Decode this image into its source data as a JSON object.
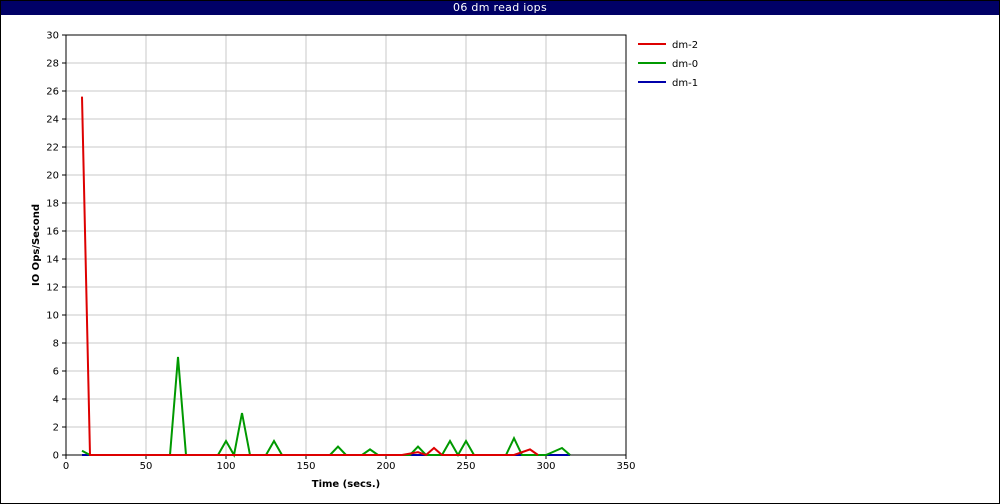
{
  "chart_data": {
    "type": "line",
    "title": "06 dm read iops",
    "xlabel": "Time (secs.)",
    "ylabel": "IO Ops/Second",
    "xlim": [
      0,
      350
    ],
    "ylim": [
      0,
      30
    ],
    "xticks": [
      0,
      50,
      100,
      150,
      200,
      250,
      300,
      350
    ],
    "yticks": [
      0,
      2,
      4,
      6,
      8,
      10,
      12,
      14,
      16,
      18,
      20,
      22,
      24,
      26,
      28,
      30
    ],
    "grid": true,
    "legend_position": "right",
    "series": [
      {
        "name": "dm-2",
        "color": "#dd0000",
        "x": [
          10,
          15,
          20,
          30,
          40,
          50,
          60,
          70,
          80,
          90,
          100,
          110,
          120,
          130,
          140,
          150,
          160,
          170,
          180,
          190,
          200,
          210,
          220,
          225,
          230,
          235,
          240,
          250,
          260,
          270,
          280,
          290,
          295
        ],
        "y": [
          25.6,
          0,
          0,
          0,
          0,
          0,
          0,
          0,
          0,
          0,
          0,
          0,
          0,
          0,
          0,
          0,
          0,
          0,
          0,
          0,
          0,
          0,
          0.2,
          0,
          0.5,
          0,
          0,
          0,
          0,
          0,
          0,
          0.4,
          0
        ]
      },
      {
        "name": "dm-0",
        "color": "#009900",
        "x": [
          10,
          15,
          20,
          30,
          40,
          50,
          60,
          65,
          70,
          75,
          80,
          90,
          95,
          100,
          105,
          110,
          115,
          120,
          125,
          130,
          135,
          140,
          150,
          160,
          165,
          170,
          175,
          180,
          185,
          190,
          195,
          200,
          210,
          215,
          220,
          225,
          230,
          235,
          240,
          245,
          250,
          255,
          260,
          270,
          275,
          280,
          285,
          290,
          300,
          310,
          315
        ],
        "y": [
          0.3,
          0,
          0,
          0,
          0,
          0,
          0,
          0,
          7.0,
          0,
          0,
          0,
          0,
          1.0,
          0,
          3.0,
          0,
          0,
          0,
          1.0,
          0,
          0,
          0,
          0,
          0,
          0.6,
          0,
          0,
          0,
          0.4,
          0,
          0,
          0,
          0,
          0.6,
          0,
          0,
          0,
          1.0,
          0,
          1.0,
          0,
          0,
          0,
          0,
          1.2,
          0,
          0,
          0,
          0.5,
          0
        ]
      },
      {
        "name": "dm-1",
        "color": "#0000aa",
        "x": [
          10,
          15,
          20,
          30,
          40,
          50,
          60,
          70,
          80,
          90,
          100,
          110,
          120,
          130,
          140,
          150,
          160,
          170,
          180,
          190,
          200,
          210,
          220,
          230,
          240,
          250,
          260,
          270,
          280,
          290,
          300,
          310,
          315
        ],
        "y": [
          0,
          0,
          0,
          0,
          0,
          0,
          0,
          0,
          0,
          0,
          0,
          0,
          0,
          0,
          0,
          0,
          0,
          0,
          0,
          0,
          0,
          0,
          0,
          0,
          0,
          0,
          0,
          0,
          0,
          0,
          0,
          0,
          0
        ]
      }
    ]
  }
}
